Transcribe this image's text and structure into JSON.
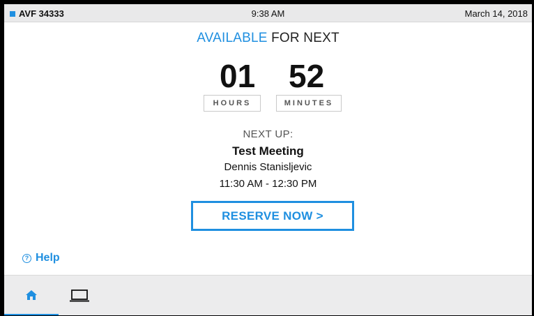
{
  "status": {
    "room": "AVF 34333",
    "time": "9:38 AM",
    "date": "March 14, 2018",
    "accent_color": "#1f8fe0"
  },
  "availability": {
    "label_accent": "AVAILABLE",
    "label_rest": " FOR NEXT",
    "hours": "01",
    "minutes": "52",
    "hours_unit": "HOURS",
    "minutes_unit": "MINUTES"
  },
  "next_meeting": {
    "label": "NEXT UP:",
    "title": "Test Meeting",
    "organizer": "Dennis Stanisljevic",
    "time_range": "11:30 AM - 12:30 PM"
  },
  "actions": {
    "reserve_label": "RESERVE NOW >",
    "help_label": "Help"
  },
  "nav": {
    "items": [
      {
        "name": "home",
        "icon": "home-icon",
        "active": true
      },
      {
        "name": "laptop",
        "icon": "laptop-icon",
        "active": false
      }
    ]
  }
}
